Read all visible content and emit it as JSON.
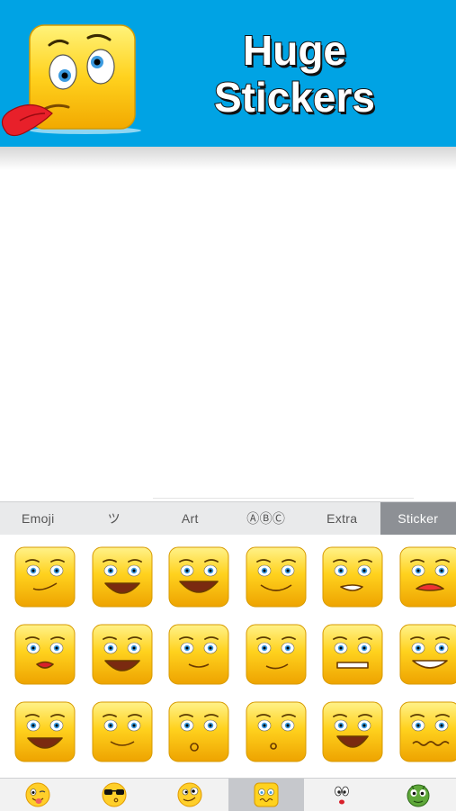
{
  "banner": {
    "title_line1": "Huge",
    "title_line2": "Stickers",
    "mascot_icon": "tongue-out-square-face-icon",
    "background_color": "#00a3e4"
  },
  "tabs": [
    {
      "label": "Emoji",
      "active": false
    },
    {
      "label": "ツ",
      "active": false
    },
    {
      "label": "Art",
      "active": false
    },
    {
      "label": "ⒶⒷⒸ",
      "active": false
    },
    {
      "label": "Extra",
      "active": false
    },
    {
      "label": "Sticker",
      "active": true
    }
  ],
  "stickers": [
    "wink-smirk-face-icon",
    "grin-face-icon",
    "big-grin-face-icon",
    "content-closed-eyes-face-icon",
    "grimace-face-icon",
    "tongue-face-icon",
    "red-lips-face-icon",
    "laughing-face-icon",
    "relieved-face-icon",
    "blushing-wink-face-icon",
    "teeth-clench-face-icon",
    "smiling-teeth-face-icon",
    "wink-laugh-face-icon",
    "smile-face-icon",
    "kiss-blush-face-icon",
    "whistle-face-icon",
    "goofy-grin-face-icon",
    "wavy-mouth-face-icon"
  ],
  "bottom_categories": [
    {
      "icon": "tongue-wink-emoji-icon",
      "active": false
    },
    {
      "icon": "sunglasses-kiss-emoji-icon",
      "active": false
    },
    {
      "icon": "crazy-face-emoji-icon",
      "active": false
    },
    {
      "icon": "square-sticker-icon",
      "active": true
    },
    {
      "icon": "cartoon-face-icon",
      "active": false
    },
    {
      "icon": "alien-face-icon",
      "active": false
    }
  ]
}
